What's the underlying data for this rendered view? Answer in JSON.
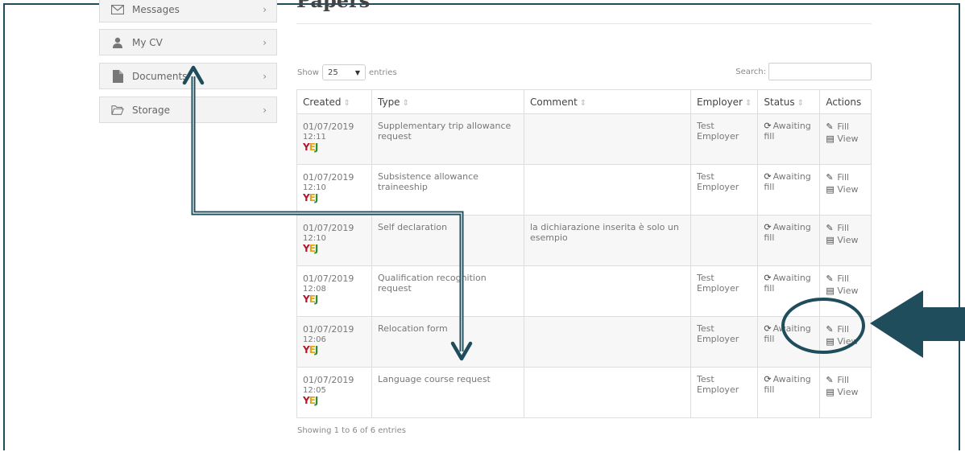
{
  "sidebar": {
    "items": [
      {
        "label": "Messages",
        "icon": "envelope-icon"
      },
      {
        "label": "My CV",
        "icon": "user-icon"
      },
      {
        "label": "Documents",
        "icon": "file-icon"
      },
      {
        "label": "Storage",
        "icon": "folder-open-icon"
      }
    ],
    "chevron": "›"
  },
  "main": {
    "title": "Papers",
    "show_label": "Show",
    "show_value": "25",
    "entries_label": "entries",
    "search_label": "Search:",
    "footer": "Showing 1 to 6 of 6 entries",
    "sort_glyph": "⇕",
    "columns": [
      "Created",
      "Type",
      "Comment",
      "Employer",
      "Status",
      "Actions"
    ],
    "rows": [
      {
        "date": "01/07/2019",
        "time": "12:11",
        "type": "Supplementary trip allowance request",
        "comment": "",
        "employer": "Test Employer",
        "status": "Awaiting fill"
      },
      {
        "date": "01/07/2019",
        "time": "12:10",
        "type": "Subsistence allowance traineeship",
        "comment": "",
        "employer": "Test Employer",
        "status": "Awaiting fill"
      },
      {
        "date": "01/07/2019",
        "time": "12:10",
        "type": "Self declaration",
        "comment": "la dichiarazione inserita è solo un esempio",
        "employer": "",
        "status": "Awaiting fill"
      },
      {
        "date": "01/07/2019",
        "time": "12:08",
        "type": "Qualification recognition request",
        "comment": "",
        "employer": "Test Employer",
        "status": "Awaiting fill"
      },
      {
        "date": "01/07/2019",
        "time": "12:06",
        "type": "Relocation form",
        "comment": "",
        "employer": "Test Employer",
        "status": "Awaiting fill"
      },
      {
        "date": "01/07/2019",
        "time": "12:05",
        "type": "Language course request",
        "comment": "",
        "employer": "Test Employer",
        "status": "Awaiting fill"
      }
    ],
    "actions": {
      "fill": "Fill",
      "view": "View"
    }
  },
  "colors": {
    "annotation": "#1f4d5c",
    "logo": [
      "#b6152c",
      "#e2a51d",
      "#2e8b3c"
    ]
  }
}
